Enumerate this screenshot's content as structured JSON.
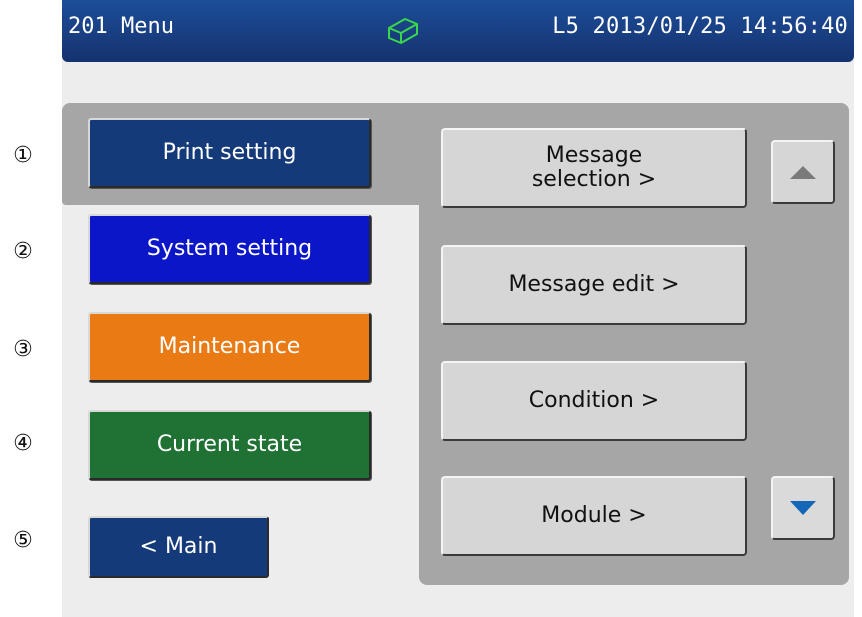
{
  "annotations": [
    "①",
    "②",
    "③",
    "④",
    "⑤"
  ],
  "titlebar": {
    "title": "201 Menu",
    "icon": "ink-cartridge-icon",
    "status": "L5 2013/01/25 14:56:40"
  },
  "nav": {
    "print_setting": "Print setting",
    "system_setting": "System setting",
    "maintenance": "Maintenance",
    "current_state": "Current state",
    "main": "< Main"
  },
  "menu": {
    "message_selection_line1": "Message",
    "message_selection_line2": "selection >",
    "message_edit": "Message edit >",
    "condition": "Condition >",
    "module": "Module >"
  },
  "scroll": {
    "up_icon": "triangle-up-icon",
    "down_icon": "triangle-down-icon"
  },
  "colors": {
    "titlebar": "#1a4186",
    "print_setting": "#153a7a",
    "system_setting": "#0b16c8",
    "maintenance": "#ea7a14",
    "current_state": "#1f7234",
    "panel": "#a6a6a6",
    "menu_button": "#d6d6d6",
    "scroll_down_arrow": "#1466b8"
  }
}
